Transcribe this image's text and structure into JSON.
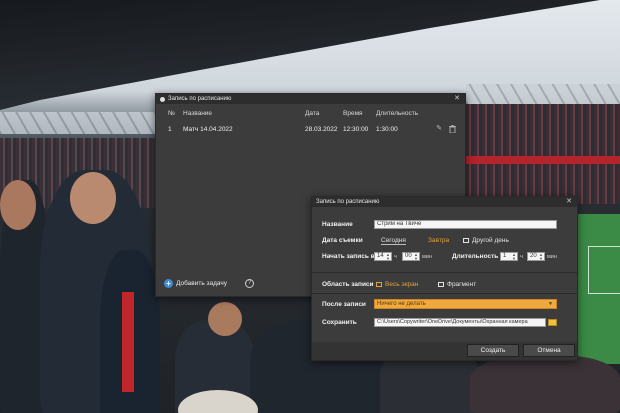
{
  "main_window": {
    "title": "Запись по расписанию",
    "columns": {
      "num": "№",
      "name": "Название",
      "date": "Дата",
      "time": "Время",
      "duration": "Длительность"
    },
    "rows": [
      {
        "num": "1",
        "name": "Матч 14.04.2022",
        "date": "28.03.2022",
        "time": "12:30:00",
        "duration": "1:30:00"
      }
    ],
    "add_task_label": "Добавить задачу",
    "help_icon_text": "?"
  },
  "dialog": {
    "title": "Запись по расписанию",
    "name_label": "Название",
    "name_value": "Стрим на Твиче",
    "date_label": "Дата съемки",
    "date_options": {
      "today": "Сегодня",
      "tomorrow": "Завтра",
      "other": "Другой день"
    },
    "date_selected": "tomorrow",
    "start_label": "Начать запись в",
    "start_hours": "14",
    "start_minutes": "00",
    "hours_unit": "ч",
    "minutes_unit": "мин",
    "duration_label": "Длительность",
    "duration_hours": "1",
    "duration_minutes": "20",
    "area_label": "Область записи",
    "area_options": {
      "full": "Весь экран",
      "fragment": "Фрагмент"
    },
    "area_selected": "full",
    "after_label": "После записи",
    "after_value": "Ничего не делать",
    "save_label": "Сохранить",
    "save_path": "C:\\Users\\Copywriter\\OneDrive\\Документы\\Охранная камера",
    "create_button": "Создать",
    "cancel_button": "Отмена"
  },
  "colors": {
    "accent": "#e3a23a",
    "dropdown": "#f2a93b",
    "add_icon": "#3d8bd8",
    "window_bg": "#3c3c3c"
  },
  "icons": {
    "edit": "pencil-icon",
    "delete": "trash-icon",
    "close": "close-icon",
    "folder": "folder-icon"
  }
}
